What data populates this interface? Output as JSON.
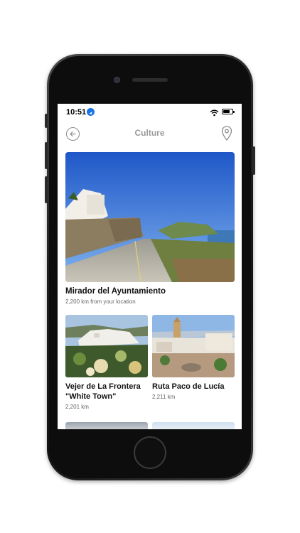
{
  "status_bar": {
    "time": "10:51"
  },
  "nav": {
    "title": "Culture"
  },
  "featured": {
    "title": "Mirador del Ayuntamiento",
    "distance": "2,200 km from your location"
  },
  "cards": [
    {
      "title": "Vejer de La Frontera \"White Town\"",
      "distance": "2,201 km"
    },
    {
      "title": "Ruta Paco de Lucía",
      "distance": "2,211 km"
    }
  ],
  "colors": {
    "accent": "#1a73e8",
    "title_gray": "#9a9a9a"
  }
}
